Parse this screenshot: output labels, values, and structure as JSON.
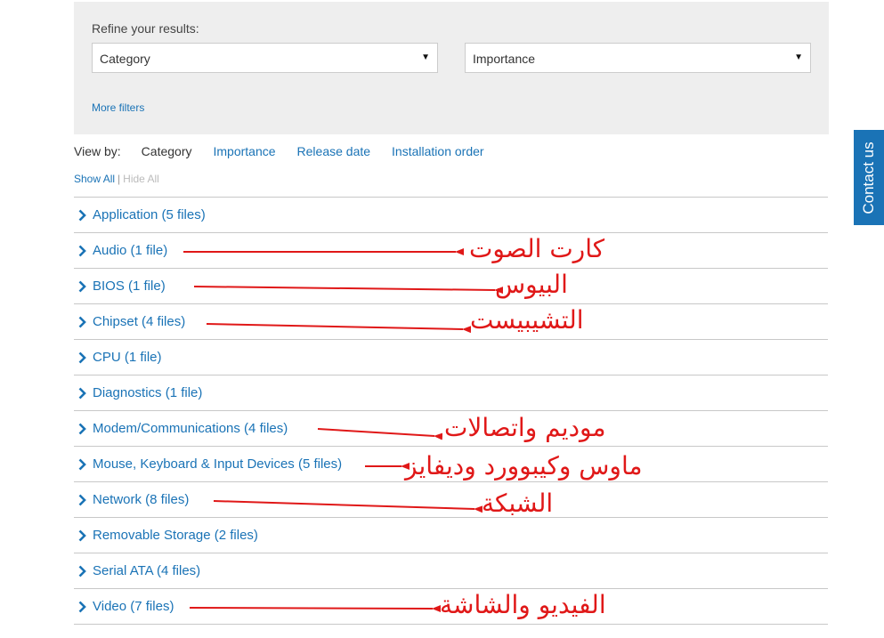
{
  "filters": {
    "refine_label": "Refine your results:",
    "category_value": "Category",
    "importance_value": "Importance",
    "more_filters": "More filters"
  },
  "view_by": {
    "label": "View by:",
    "options": [
      "Category",
      "Importance",
      "Release date",
      "Installation order"
    ],
    "active": "Category"
  },
  "toggle": {
    "show_all": "Show All",
    "separator": "|",
    "hide_all": "Hide All"
  },
  "categories": [
    {
      "label": "Application (5 files)"
    },
    {
      "label": "Audio (1 file)"
    },
    {
      "label": "BIOS (1 file)"
    },
    {
      "label": "Chipset (4 files)"
    },
    {
      "label": "CPU (1 file)"
    },
    {
      "label": "Diagnostics (1 file)"
    },
    {
      "label": "Modem/Communications (4 files)"
    },
    {
      "label": "Mouse, Keyboard & Input Devices (5 files)"
    },
    {
      "label": "Network (8 files)"
    },
    {
      "label": "Removable Storage (2 files)"
    },
    {
      "label": "Serial ATA (4 files)"
    },
    {
      "label": "Video (7 files)"
    }
  ],
  "annotations": [
    {
      "text": "كارت الصوت",
      "category": "Audio (1 file)"
    },
    {
      "text": "البيوس",
      "category": "BIOS (1 file)"
    },
    {
      "text": "التشيبيست",
      "category": "Chipset (4 files)"
    },
    {
      "text": "موديم واتصالات",
      "category": "Modem/Communications (4 files)"
    },
    {
      "text": "ماوس وكيبوورد وديفايز",
      "category": "Mouse, Keyboard & Input Devices (5 files)"
    },
    {
      "text": "الشبكة",
      "category": "Network (8 files)"
    },
    {
      "text": "الفيديو والشاشة",
      "category": "Video (7 files)"
    }
  ],
  "contact": {
    "label": "Contact us"
  },
  "colors": {
    "link": "#1a73b6",
    "annotation": "#e01818",
    "panel": "#eeeeee",
    "divider": "#c8c8c8"
  },
  "icons": {
    "expand": "chevron-right-icon",
    "dropdown": "caret-down-icon",
    "annotation_arrow": "arrow-left-icon"
  }
}
